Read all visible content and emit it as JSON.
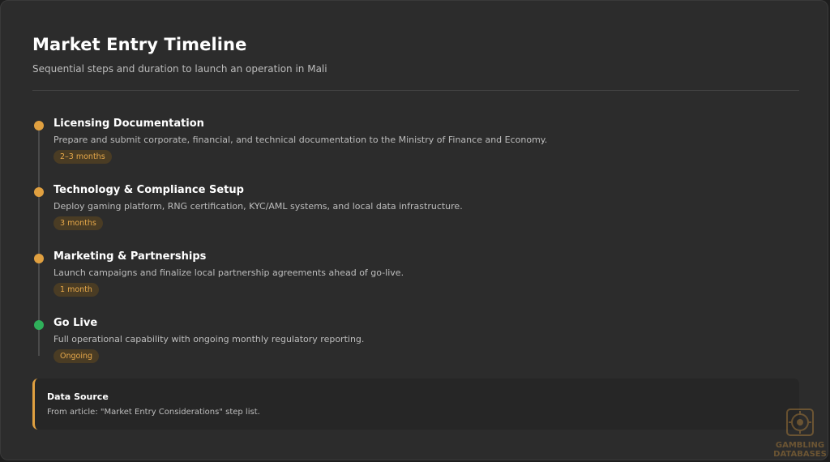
{
  "header": {
    "title": "Market Entry Timeline",
    "subtitle": "Sequential steps and duration to launch an operation in Mali"
  },
  "colors": {
    "accent": "#e0a040",
    "complete": "#2fb05a",
    "badge_bg": "#4a3c24",
    "badge_text": "#e6a84a"
  },
  "steps": [
    {
      "title": "Licensing Documentation",
      "description": "Prepare and submit corporate, financial, and technical documentation to the Ministry of Finance and Economy.",
      "duration": "2–3 months",
      "status": "pending"
    },
    {
      "title": "Technology & Compliance Setup",
      "description": "Deploy gaming platform, RNG certification, KYC/AML systems, and local data infrastructure.",
      "duration": "3 months",
      "status": "pending"
    },
    {
      "title": "Marketing & Partnerships",
      "description": "Launch campaigns and finalize local partnership agreements ahead of go-live.",
      "duration": "1 month",
      "status": "pending"
    },
    {
      "title": "Go Live",
      "description": "Full operational capability with ongoing monthly regulatory reporting.",
      "duration": "Ongoing",
      "status": "live"
    }
  ],
  "source": {
    "title": "Data Source",
    "text": "From article: \"Market Entry Considerations\" step list."
  },
  "watermark": {
    "line1": "GAMBLING",
    "line2": "DATABASES",
    "icon": "casino-chip-icon"
  }
}
